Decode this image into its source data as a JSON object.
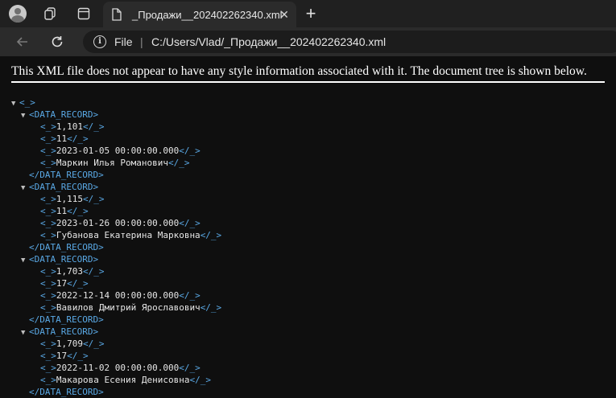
{
  "tabbar": {
    "tab_title": "_Продажи__202402262340.xml",
    "close_glyph": "✕",
    "newtab_glyph": "+"
  },
  "address": {
    "scheme_label": "File",
    "separator": "|",
    "url": "C:/Users/Vlad/_Продажи__202402262340.xml"
  },
  "page": {
    "notice": "This XML file does not appear to have any style information associated with it. The document tree is shown below.",
    "root_open": "<_>",
    "record_open": "<DATA_RECORD>",
    "record_close": "</DATA_RECORD>",
    "field_open": "<_>",
    "field_close": "</_>",
    "toggle_glyph": "▼"
  },
  "records": [
    {
      "fields": [
        "1,101",
        "11",
        "2023-01-05 00:00:00.000",
        "Маркин Илья Романович"
      ]
    },
    {
      "fields": [
        "1,115",
        "11",
        "2023-01-26 00:00:00.000",
        "Губанова Екатерина Марковна"
      ]
    },
    {
      "fields": [
        "1,703",
        "17",
        "2022-12-14 00:00:00.000",
        "Вавилов Дмитрий Ярославович"
      ]
    },
    {
      "fields": [
        "1,709",
        "17",
        "2022-11-02 00:00:00.000",
        "Макарова Есения Денисовна"
      ]
    }
  ]
}
